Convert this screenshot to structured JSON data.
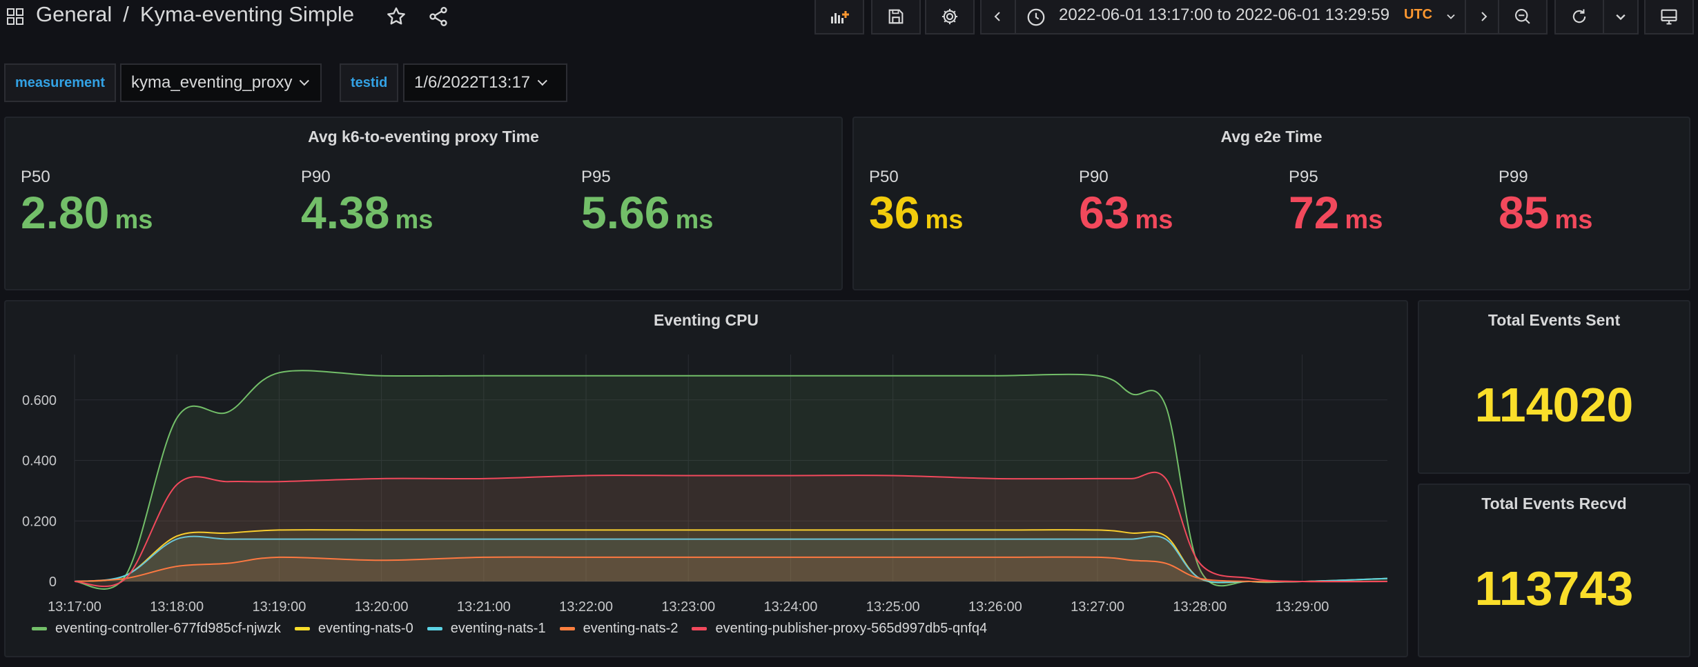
{
  "header": {
    "folder": "General",
    "separator": "/",
    "dashboard_title": "Kyma-eventing Simple"
  },
  "timepicker": {
    "range": "2022-06-01 13:17:00 to 2022-06-01 13:29:59",
    "timezone": "UTC"
  },
  "variables": [
    {
      "label": "measurement",
      "value": "kyma_eventing_proxy"
    },
    {
      "label": "testid",
      "value": "1/6/2022T13:17"
    }
  ],
  "panels": {
    "proxy_time": {
      "title": "Avg k6-to-eventing proxy Time",
      "stats": [
        {
          "label": "P50",
          "value": "2.80",
          "unit": "ms",
          "color": "#73bf69"
        },
        {
          "label": "P90",
          "value": "4.38",
          "unit": "ms",
          "color": "#73bf69"
        },
        {
          "label": "P95",
          "value": "5.66",
          "unit": "ms",
          "color": "#73bf69"
        }
      ]
    },
    "e2e_time": {
      "title": "Avg e2e Time",
      "stats": [
        {
          "label": "P50",
          "value": "36",
          "unit": "ms",
          "color": "#f2cc0c"
        },
        {
          "label": "P90",
          "value": "63",
          "unit": "ms",
          "color": "#f2495c"
        },
        {
          "label": "P95",
          "value": "72",
          "unit": "ms",
          "color": "#f2495c"
        },
        {
          "label": "P99",
          "value": "85",
          "unit": "ms",
          "color": "#f2495c"
        }
      ]
    },
    "events_sent": {
      "title": "Total Events Sent",
      "value": "114020"
    },
    "events_recvd": {
      "title": "Total Events Recvd",
      "value": "113743"
    },
    "cpu": {
      "title": "Eventing CPU"
    }
  },
  "colors": {
    "background": "#111217",
    "panel": "#181b1f",
    "green": "#73bf69",
    "yellow": "#fade2a",
    "red": "#f2495c",
    "orange": "#ff9830",
    "blue": "#33a2e5"
  },
  "chart_data": {
    "type": "line",
    "title": "Eventing CPU",
    "x": [
      "13:17:00",
      "13:17:30",
      "13:18:00",
      "13:18:30",
      "13:19:00",
      "13:20:00",
      "13:21:00",
      "13:22:00",
      "13:23:00",
      "13:24:00",
      "13:25:00",
      "13:26:00",
      "13:27:00",
      "13:27:20",
      "13:27:40",
      "13:28:00",
      "13:28:30",
      "13:29:00",
      "13:29:50"
    ],
    "x_tick_labels": [
      "13:17:00",
      "13:18:00",
      "13:19:00",
      "13:20:00",
      "13:21:00",
      "13:22:00",
      "13:23:00",
      "13:24:00",
      "13:25:00",
      "13:26:00",
      "13:27:00",
      "13:28:00",
      "13:29:00"
    ],
    "y_tick_labels": [
      "0",
      "0.200",
      "0.400",
      "0.600"
    ],
    "ylim": [
      0,
      0.75
    ],
    "grid": true,
    "fill": true,
    "legend_position": "bottom-left",
    "series": [
      {
        "name": "eventing-controller-677fd985cf-njwzk",
        "color": "#73bf69",
        "values": [
          0,
          0.02,
          0.54,
          0.56,
          0.69,
          0.68,
          0.68,
          0.68,
          0.68,
          0.68,
          0.68,
          0.68,
          0.68,
          0.62,
          0.58,
          0.04,
          0,
          0,
          0
        ]
      },
      {
        "name": "eventing-nats-0",
        "color": "#fade2a",
        "values": [
          0,
          0.02,
          0.15,
          0.16,
          0.17,
          0.17,
          0.17,
          0.17,
          0.17,
          0.17,
          0.17,
          0.17,
          0.17,
          0.16,
          0.15,
          0.01,
          0,
          0,
          0.01
        ]
      },
      {
        "name": "eventing-nats-1",
        "color": "#5cd3e5",
        "values": [
          0,
          0.02,
          0.14,
          0.14,
          0.14,
          0.14,
          0.14,
          0.14,
          0.14,
          0.14,
          0.14,
          0.14,
          0.14,
          0.14,
          0.14,
          0.01,
          0,
          0,
          0.01
        ]
      },
      {
        "name": "eventing-nats-2",
        "color": "#ff7f3f",
        "values": [
          0,
          0.01,
          0.05,
          0.06,
          0.08,
          0.07,
          0.08,
          0.08,
          0.08,
          0.08,
          0.08,
          0.08,
          0.08,
          0.07,
          0.06,
          0.01,
          0,
          0,
          0
        ]
      },
      {
        "name": "eventing-publisher-proxy-565d997db5-qnfq4",
        "color": "#f2495c",
        "values": [
          0,
          0.01,
          0.32,
          0.33,
          0.33,
          0.34,
          0.34,
          0.35,
          0.35,
          0.35,
          0.35,
          0.34,
          0.34,
          0.34,
          0.34,
          0.06,
          0.01,
          0,
          0
        ]
      }
    ]
  }
}
